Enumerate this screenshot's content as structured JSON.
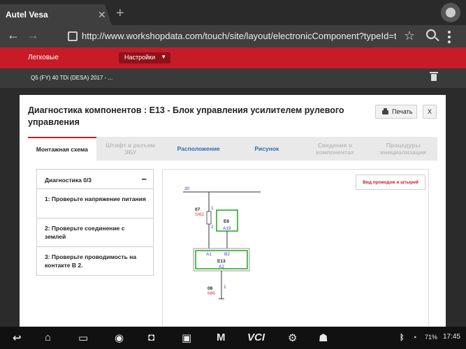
{
  "browser": {
    "tab_title": "Autel Vesa",
    "tab_close": "✕",
    "new_tab": "+",
    "url": "http://www.workshopdata.com/touch/site/layout/electronicComponent?typeId=t_"
  },
  "app": {
    "section_label": "Легковые",
    "settings_label": "Настройки",
    "vehicle": "Q5 (FY) 40 TDi (DESA) 2017 - ..."
  },
  "modal": {
    "title": "Диагностика компонентов : E13 - Блок управления усилителем рулевого управления",
    "print_label": "Печать",
    "close_label": "X",
    "tabs": [
      {
        "label": "Монтажная схема"
      },
      {
        "label": "Штифт в разъем ЭБУ"
      },
      {
        "label": "Расположение"
      },
      {
        "label": "Рисунок"
      },
      {
        "label": "Сведения о компонентах"
      },
      {
        "label": "Процедуры инициализации"
      }
    ],
    "diagnosis": {
      "header": "Диагностика 0/3",
      "collapse": "−",
      "steps": [
        {
          "label": "1: Проверьте напряжение питания"
        },
        {
          "label": "2: Проверьте соединение с землей"
        },
        {
          "label": "3: Проверьте проводимость на контакте B 2."
        }
      ]
    },
    "schematic": {
      "wires_button": "Вид проводов и штырей",
      "bus_label": "30",
      "fuse_id": "07",
      "fuse_code": "SI62",
      "pin_1": "1",
      "pin_2": "2",
      "e6_label": "E6",
      "e6_pin": "A19",
      "e13_label": "E13",
      "e13_pin_a1": "A1",
      "e13_pin_b2": "B2",
      "e13_pin_a2": "A2",
      "ground_id": "08",
      "ground_code": "686",
      "ground_pin": "1",
      "colors": {
        "green": "#1fa51f",
        "red": "#d43a3a",
        "blue": "#3b3bd6"
      }
    }
  },
  "system": {
    "clock": "17:45",
    "battery": "71%",
    "vci_label": "VCI"
  }
}
